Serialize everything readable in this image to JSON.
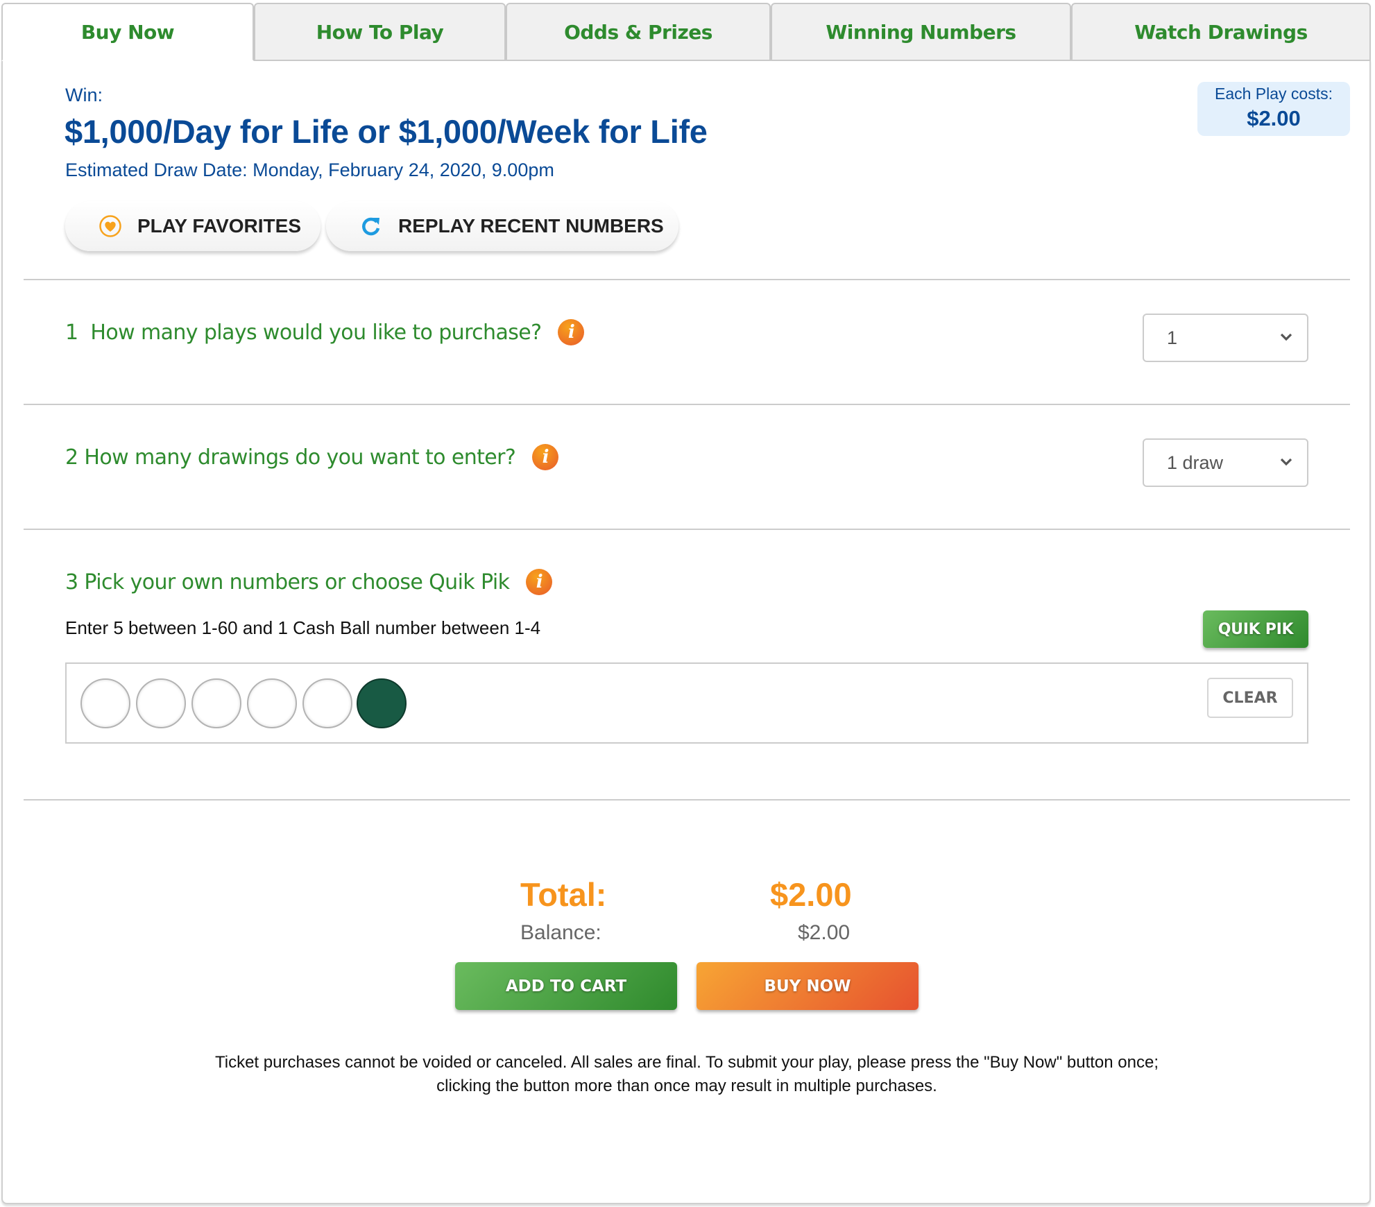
{
  "tabs": [
    {
      "label": "Buy Now",
      "active": true
    },
    {
      "label": "How To Play",
      "active": false
    },
    {
      "label": "Odds & Prizes",
      "active": false
    },
    {
      "label": "Winning Numbers",
      "active": false
    },
    {
      "label": "Watch Drawings",
      "active": false
    }
  ],
  "header": {
    "win_label": "Win:",
    "prize_title": "$1,000/Day for Life or $1,000/Week for Life",
    "draw_date": "Estimated Draw Date: Monday, February 24, 2020, 9.00pm"
  },
  "price": {
    "label": "Each Play costs:",
    "value": "$2.00"
  },
  "quick_actions": {
    "play_favorites": {
      "label": "PLAY FAVORITES",
      "icon": "heart-icon"
    },
    "replay_recent": {
      "label": "REPLAY RECENT NUMBERS",
      "icon": "refresh-icon"
    }
  },
  "steps": [
    {
      "title": "1  How many plays would you like to purchase?",
      "info_icon": "info-icon",
      "select_value": "1"
    },
    {
      "title": "2 How many drawings do you want to enter?",
      "info_icon": "info-icon",
      "select_value": "1 draw"
    },
    {
      "title": "3 Pick your own numbers or choose Quik Pik",
      "info_icon": "info-icon",
      "instructions": "Enter 5 between 1-60 and 1 Cash Ball number between 1-4",
      "quik_pik_label": "QUIK PIK",
      "clear_label": "CLEAR",
      "balls": [
        {
          "type": "main",
          "value": ""
        },
        {
          "type": "main",
          "value": ""
        },
        {
          "type": "main",
          "value": ""
        },
        {
          "type": "main",
          "value": ""
        },
        {
          "type": "main",
          "value": ""
        },
        {
          "type": "cash",
          "value": ""
        }
      ]
    }
  ],
  "colors": {
    "brand_green": "#2e8b2e",
    "brand_blue": "#0a4a96",
    "accent_orange": "#f7941d",
    "cash_ball": "#185a44"
  },
  "summary": {
    "total_label": "Total:",
    "total_value": "$2.00",
    "balance_label": "Balance:",
    "balance_value": "$2.00"
  },
  "actions": {
    "add_to_cart": "ADD TO CART",
    "buy_now": "BUY NOW"
  },
  "disclaimer": "Ticket purchases cannot be voided or canceled. All sales are final. To submit your play, please press the \"Buy Now\" button once; clicking the button more than once may result in multiple purchases."
}
